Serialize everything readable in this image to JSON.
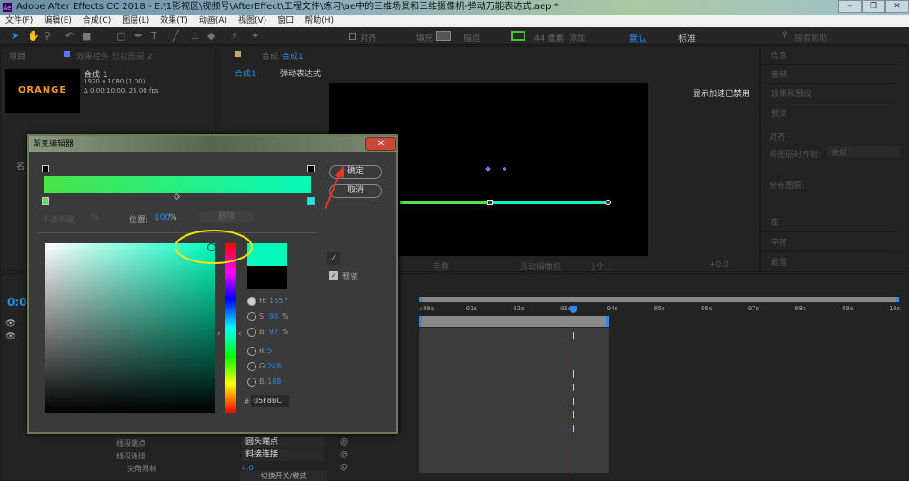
{
  "window": {
    "title": "Adobe After Effects CC 2018 - E:\\1影视区\\视频号\\AfterEffect\\工程文件\\练习\\ae中的三维场景和三维摄像机-弹动万能表达式.aep *",
    "logo": "Ae"
  },
  "menu": [
    "文件(F)",
    "编辑(E)",
    "合成(C)",
    "图层(L)",
    "效果(T)",
    "动画(A)",
    "视图(V)",
    "窗口",
    "帮助(H)"
  ],
  "toolbar": {
    "align_label": "对齐",
    "fill_label": "填充",
    "stroke_label": "描边",
    "stroke_px": "44 像素",
    "add_label": "添加",
    "workspace_default": "默认",
    "workspace_standard": "标准",
    "search_placeholder": "搜索帮助"
  },
  "project": {
    "tab": "项目",
    "effects_tab": "效果控件 形状图层 2",
    "thumbnail_text": "ORANGE",
    "comp_name": "合成 1",
    "resolution": "1920 x 1080 (1.00)",
    "duration": "Δ 0:00:10:00, 25.00 fps",
    "name_col": "名"
  },
  "viewer": {
    "tab_prefix": "合成",
    "tab_name": "合成1",
    "breadcrumb_root": "合成1",
    "breadcrumb_child": "弹动表达式",
    "notice": "显示加速已禁用",
    "quality": "完整",
    "camera": "活动摄像机",
    "view_count": "1个...",
    "exposure": "+0.0"
  },
  "right_panel": [
    "信息",
    "音频",
    "效果和预设",
    "预览",
    "对齐",
    "库",
    "字符",
    "段落"
  ],
  "align": {
    "align_to_label": "将图层对齐到:",
    "align_to_value": "合成",
    "distribute_label": "分布图层:"
  },
  "dialog": {
    "title": "渐变编辑器",
    "ok": "确定",
    "cancel": "取消",
    "opacity_label": "不透明度:",
    "opacity_unit": "%",
    "position_label": "位置:",
    "position_value": "100",
    "position_unit": "%",
    "delete": "删除",
    "preview_label": "预览",
    "preview_checked": true,
    "gradient": {
      "start": "#4be54a",
      "end": "#05f8bc"
    },
    "new_color": "#05F8BC",
    "old_color": "#000000",
    "hsb": [
      {
        "label": "H:",
        "value": "165",
        "unit": "°",
        "selected": true
      },
      {
        "label": "S:",
        "value": "98",
        "unit": "%"
      },
      {
        "label": "B:",
        "value": "97",
        "unit": "%"
      }
    ],
    "rgb": [
      {
        "label": "R:",
        "value": "5"
      },
      {
        "label": "G:",
        "value": "248"
      },
      {
        "label": "B:",
        "value": "188"
      }
    ],
    "hex_label": "#",
    "hex": "05F8BC"
  },
  "timeline": {
    "timecode": "0:0",
    "ruler": [
      ":00s",
      "01s",
      "02s",
      "03s",
      "04s",
      "05s",
      "06s",
      "07s",
      "08s",
      "09s",
      "10s"
    ],
    "playhead_s": 3.25,
    "layer_end_s": 4,
    "props": [
      {
        "name": "线段端点",
        "value": "圆头端点"
      },
      {
        "name": "线段连接",
        "value": "斜接连接"
      },
      {
        "name": "尖角限制",
        "value": "4.0"
      }
    ],
    "toggle_label": "切换开关/模式"
  },
  "colors": {
    "accent": "#2d8ceb",
    "annotation_circle": "#f5e400",
    "annotation_arrow": "#e8352a"
  }
}
